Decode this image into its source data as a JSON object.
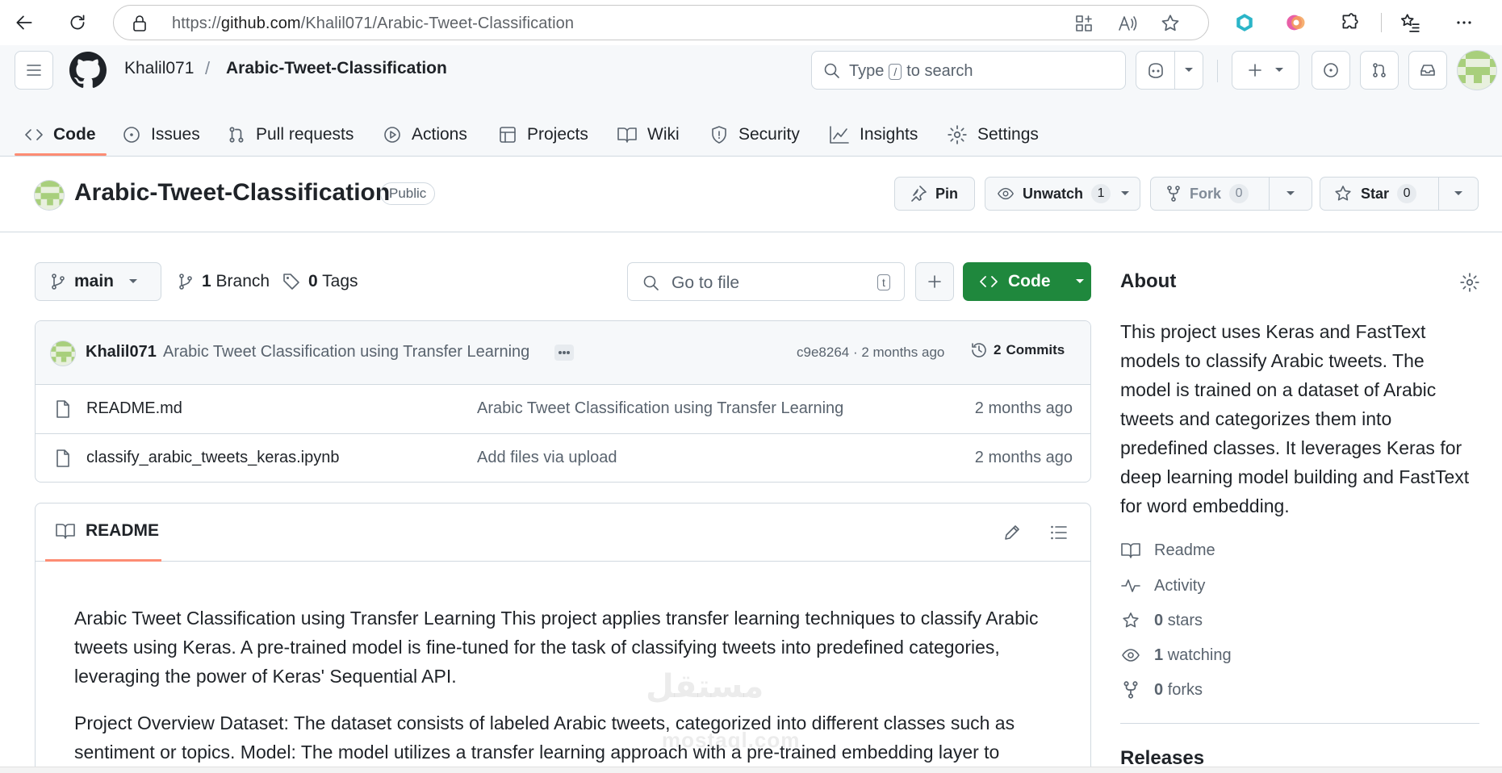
{
  "browser": {
    "url_prefix": "https://",
    "url_host": "github.com",
    "url_path": "/Khalil071/Arabic-Tweet-Classification"
  },
  "header": {
    "owner": "Khalil071",
    "slash": "/",
    "repo": "Arabic-Tweet-Classification",
    "search_type": "Type",
    "search_key": "/",
    "search_rest": "to search"
  },
  "tabs": [
    {
      "label": "Code"
    },
    {
      "label": "Issues"
    },
    {
      "label": "Pull requests"
    },
    {
      "label": "Actions"
    },
    {
      "label": "Projects"
    },
    {
      "label": "Wiki"
    },
    {
      "label": "Security"
    },
    {
      "label": "Insights"
    },
    {
      "label": "Settings"
    }
  ],
  "repo": {
    "title": "Arabic-Tweet-Classification",
    "visibility": "Public",
    "pin_label": "Pin",
    "unwatch_label": "Unwatch",
    "unwatch_count": "1",
    "fork_label": "Fork",
    "fork_count": "0",
    "star_label": "Star",
    "star_count": "0"
  },
  "toolbar": {
    "branch": "main",
    "branches_count": "1",
    "branches_label": "Branch",
    "tags_count": "0",
    "tags_label": "Tags",
    "goto_placeholder": "Go to file",
    "goto_key": "t",
    "code_label": "Code"
  },
  "commit": {
    "author": "Khalil071",
    "message": "Arabic Tweet Classification using Transfer Learning",
    "hash_time": "c9e8264 · 2 months ago",
    "commits_count": "2",
    "commits_label": "Commits"
  },
  "files": [
    {
      "name": "README.md",
      "message": "Arabic Tweet Classification using Transfer Learning",
      "date": "2 months ago"
    },
    {
      "name": "classify_arabic_tweets_keras.ipynb",
      "message": "Add files via upload",
      "date": "2 months ago"
    }
  ],
  "readme": {
    "tab_label": "README",
    "p1": "Arabic Tweet Classification using Transfer Learning This project applies transfer learning techniques to classify Arabic tweets using Keras. A pre-trained model is fine-tuned for the task of classifying tweets into predefined categories, leveraging the power of Keras' Sequential API.",
    "p2": "Project Overview Dataset: The dataset consists of labeled Arabic tweets, categorized into different classes such as sentiment or topics. Model: The model utilizes a transfer learning approach with a pre-trained embedding layer to"
  },
  "about": {
    "title": "About",
    "description": "This project uses Keras and FastText models to classify Arabic tweets. The model is trained on a dataset of Arabic tweets and categorizes them into predefined classes. It leverages Keras for deep learning model building and FastText for word embedding.",
    "readme": "Readme",
    "activity": "Activity",
    "stars_count": "0",
    "stars_label": "stars",
    "watching_count": "1",
    "watching_label": "watching",
    "forks_count": "0",
    "forks_label": "forks",
    "releases_title": "Releases"
  },
  "watermark": {
    "text": "مستقل",
    "sub": "mostaql.com"
  },
  "colors": {
    "accent_underline": "#fd8c73",
    "code_button": "#1f883d",
    "header_bg": "#f6f8fa"
  }
}
